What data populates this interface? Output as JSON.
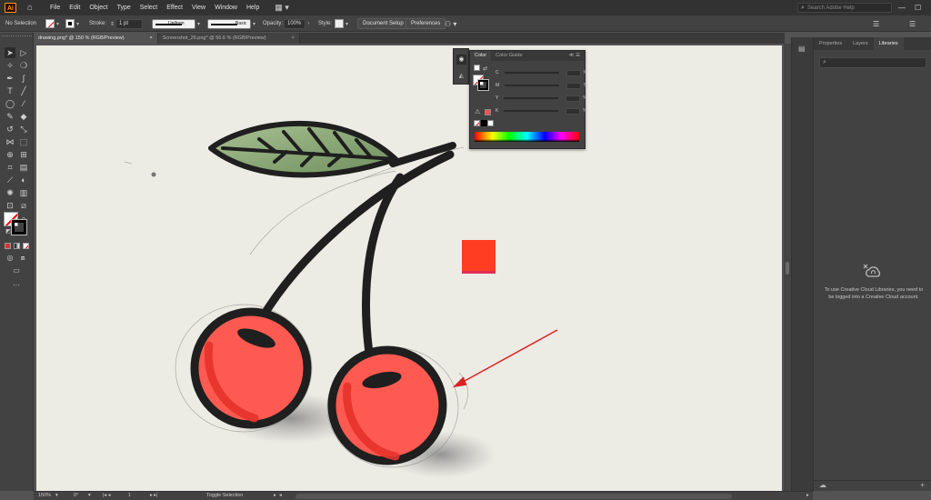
{
  "app": {
    "logo": "Ai",
    "workspace_icon": "workspace-switcher-icon"
  },
  "menu": [
    "File",
    "Edit",
    "Object",
    "Type",
    "Select",
    "Effect",
    "View",
    "Window",
    "Help"
  ],
  "search": {
    "placeholder": "Search Adobe Help"
  },
  "window_controls": [
    "—",
    "☐",
    "✕"
  ],
  "control_bar": {
    "selection_label": "No Selection",
    "stroke_label": "Stroke:",
    "stroke_weight": "1 pt",
    "stroke_profile": "Uniform",
    "brush": "Basic",
    "opacity_label": "Opacity:",
    "opacity_value": "100%",
    "style_label": "Style:",
    "document_setup": "Document Setup",
    "preferences": "Preferences"
  },
  "tabs": [
    {
      "label": "drawing.png* @ 150 % (RGB/Preview)",
      "close": "×"
    },
    {
      "label": "Screenshot_26.png* @ 56.6 % (RGB/Preview)",
      "close": "×"
    }
  ],
  "color_panel": {
    "tabs": [
      "Color",
      "Color Guide"
    ],
    "menu": "≪ ☰",
    "channels": [
      {
        "name": "C",
        "unit": "%"
      },
      {
        "name": "M",
        "unit": "%"
      },
      {
        "name": "Y",
        "unit": "%"
      },
      {
        "name": "K",
        "unit": "%"
      }
    ]
  },
  "right_panel": {
    "tabs": [
      "Properties",
      "Layers",
      "Libraries"
    ],
    "message": "To use Creative Cloud Libraries, you need to be logged into a Creative Cloud account."
  },
  "status_bar": {
    "zoom": "150%",
    "rotation": "0°",
    "artboard": "1",
    "mode": "Toggle Selection"
  },
  "colors": {
    "cherry_red": "#ff5a52",
    "cherry_shade": "#e5322b",
    "outline": "#1f1f1f",
    "leaf": "#8aa876",
    "square": "#ff3d22",
    "arrow": "#dd2020",
    "paper": "#ecebe4"
  }
}
